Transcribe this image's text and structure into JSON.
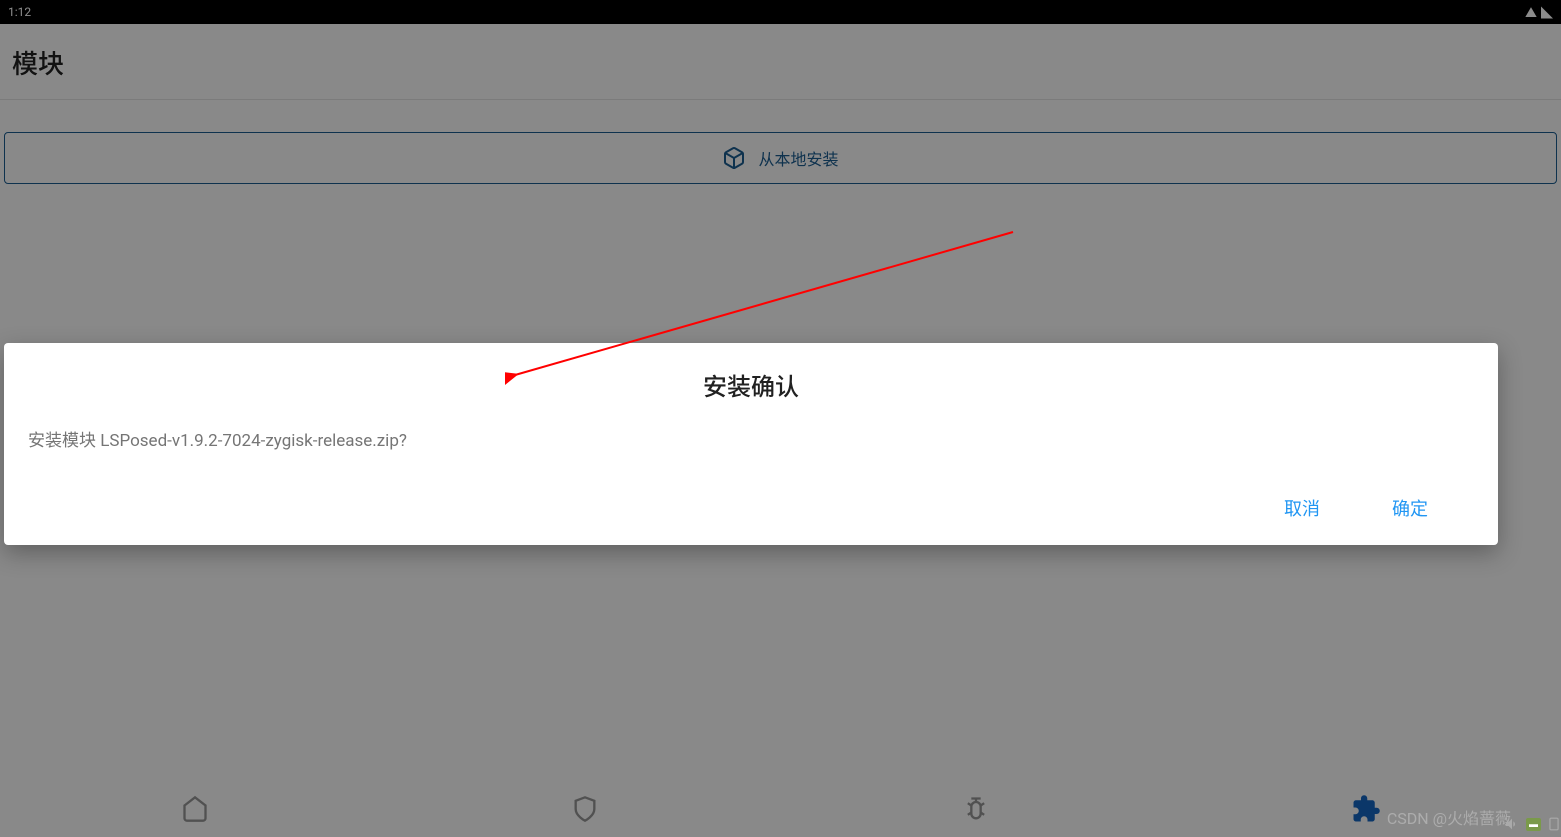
{
  "status_bar": {
    "time": "1:12"
  },
  "header": {
    "title": "模块"
  },
  "main": {
    "install_button_label": "从本地安装"
  },
  "dialog": {
    "title": "安装确认",
    "message": "安装模块 LSPosed-v1.9.2-7024-zygisk-release.zip?",
    "cancel_label": "取消",
    "confirm_label": "确定"
  },
  "watermark": "CSDN @火焰蔷薇",
  "colors": {
    "accent": "#2196f3",
    "primary_dark": "#1a5b8f"
  }
}
